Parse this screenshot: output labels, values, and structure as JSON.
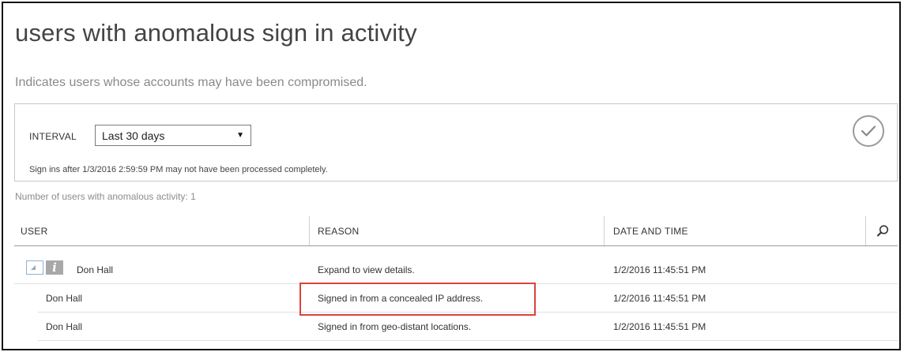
{
  "page": {
    "title": "users with anomalous sign in activity",
    "subtitle": "Indicates users whose accounts may have been compromised."
  },
  "filter": {
    "interval_label": "INTERVAL",
    "interval_value": "Last 30 days",
    "notice": "Sign ins after 1/3/2016 2:59:59 PM may not have been processed completely.",
    "apply_icon": "checkmark-circle-icon"
  },
  "summary": {
    "count_text": "Number of users with anomalous activity: 1"
  },
  "table": {
    "columns": [
      "USER",
      "REASON",
      "DATE AND TIME"
    ],
    "search_icon": "search-icon",
    "rows": [
      {
        "user": "Don Hall",
        "reason": "Expand to view details.",
        "datetime": "1/2/2016 11:45:51 PM",
        "expandable": true
      },
      {
        "user": "Don Hall",
        "reason": "Signed in from a concealed IP address.",
        "datetime": "1/2/2016 11:45:51 PM",
        "highlighted": true
      },
      {
        "user": "Don Hall",
        "reason": "Signed in from geo-distant locations.",
        "datetime": "1/2/2016 11:45:51 PM"
      }
    ]
  },
  "colors": {
    "highlight_border": "#d9443c",
    "expand_border": "#8fb0d6",
    "info_bg": "#a8a8a8"
  }
}
